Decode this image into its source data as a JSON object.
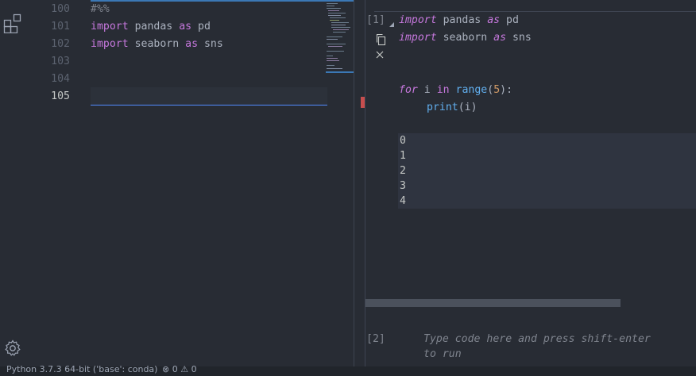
{
  "editor": {
    "lines": [
      {
        "number": "100",
        "text": "#%%"
      },
      {
        "number": "101",
        "kw": "import",
        "mod": "pandas",
        "as": "as",
        "alias": "pd"
      },
      {
        "number": "102",
        "kw": "import",
        "mod": "seaborn",
        "as": "as",
        "alias": "sns"
      },
      {
        "number": "103"
      },
      {
        "number": "104"
      },
      {
        "number": "105"
      }
    ]
  },
  "interactive": {
    "cell1": {
      "prompt": "[1]",
      "line1": {
        "kw": "import",
        "mod": "pandas",
        "as": "as",
        "alias": "pd"
      },
      "line2": {
        "kw": "import",
        "mod": "seaborn",
        "as": "as",
        "alias": "sns"
      },
      "loop": {
        "kw_for": "for",
        "var": "i",
        "kw_in": "in",
        "fn_range": "range",
        "num": "5",
        "fn_print": "print"
      },
      "output": [
        "0",
        "1",
        "2",
        "3",
        "4"
      ]
    },
    "cell2": {
      "prompt": "[2]",
      "placeholder_line1": "Type code here and press shift-enter",
      "placeholder_line2": "to run"
    }
  },
  "statusbar": {
    "python": "Python 3.7.3 64-bit ('base': conda)",
    "problems": "⊗ 0 ⚠ 0"
  },
  "icons": [
    "extensions-icon",
    "gear-icon",
    "copy-icon",
    "close-icon",
    "collapse-icon"
  ]
}
